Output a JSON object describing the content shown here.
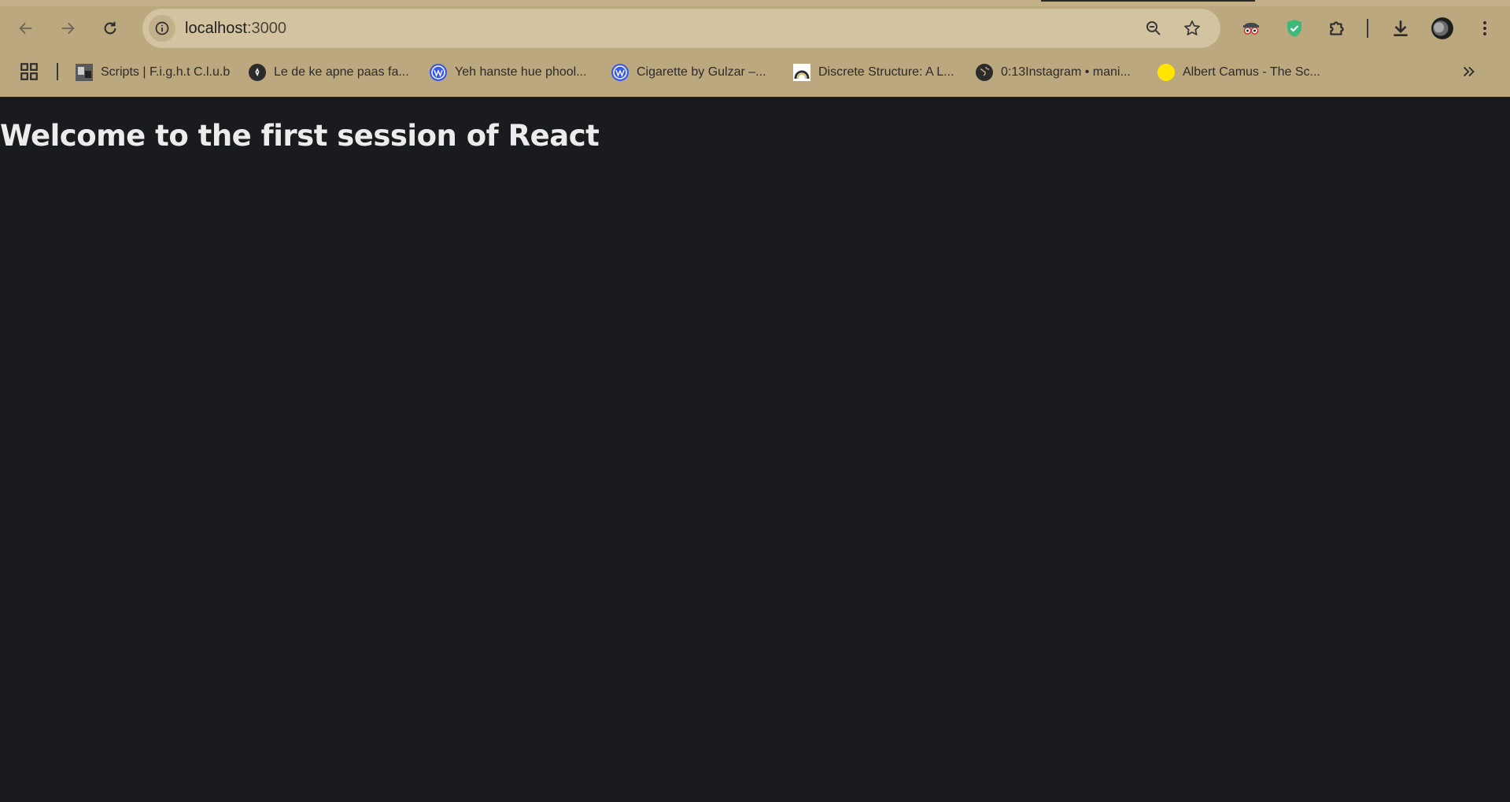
{
  "browser": {
    "address_bar": {
      "host": "localhost",
      "port": ":3000"
    },
    "bookmarks": [
      {
        "label": "Scripts | F.i.g.h.t C.l.u.b",
        "icon": "movie-thumbnail-icon"
      },
      {
        "label": "Le de ke apne paas fa...",
        "icon": "pen-nib-icon"
      },
      {
        "label": "Yeh hanste hue phool...",
        "icon": "wordpress-icon"
      },
      {
        "label": "Cigarette by Gulzar –...",
        "icon": "wordpress-icon"
      },
      {
        "label": "Discrete Structure: A L...",
        "icon": "arch-icon"
      },
      {
        "label": "0:13Instagram • mani...",
        "icon": "globe-icon"
      },
      {
        "label": "Albert Camus - The Sc...",
        "icon": "yellow-circle-icon"
      }
    ]
  },
  "page": {
    "heading": "Welcome to the first session of React"
  },
  "colors": {
    "chrome": "#bca87f",
    "omnibox": "#d3c3a1",
    "page_background": "#1a1b1e",
    "heading_text": "#ececec"
  }
}
